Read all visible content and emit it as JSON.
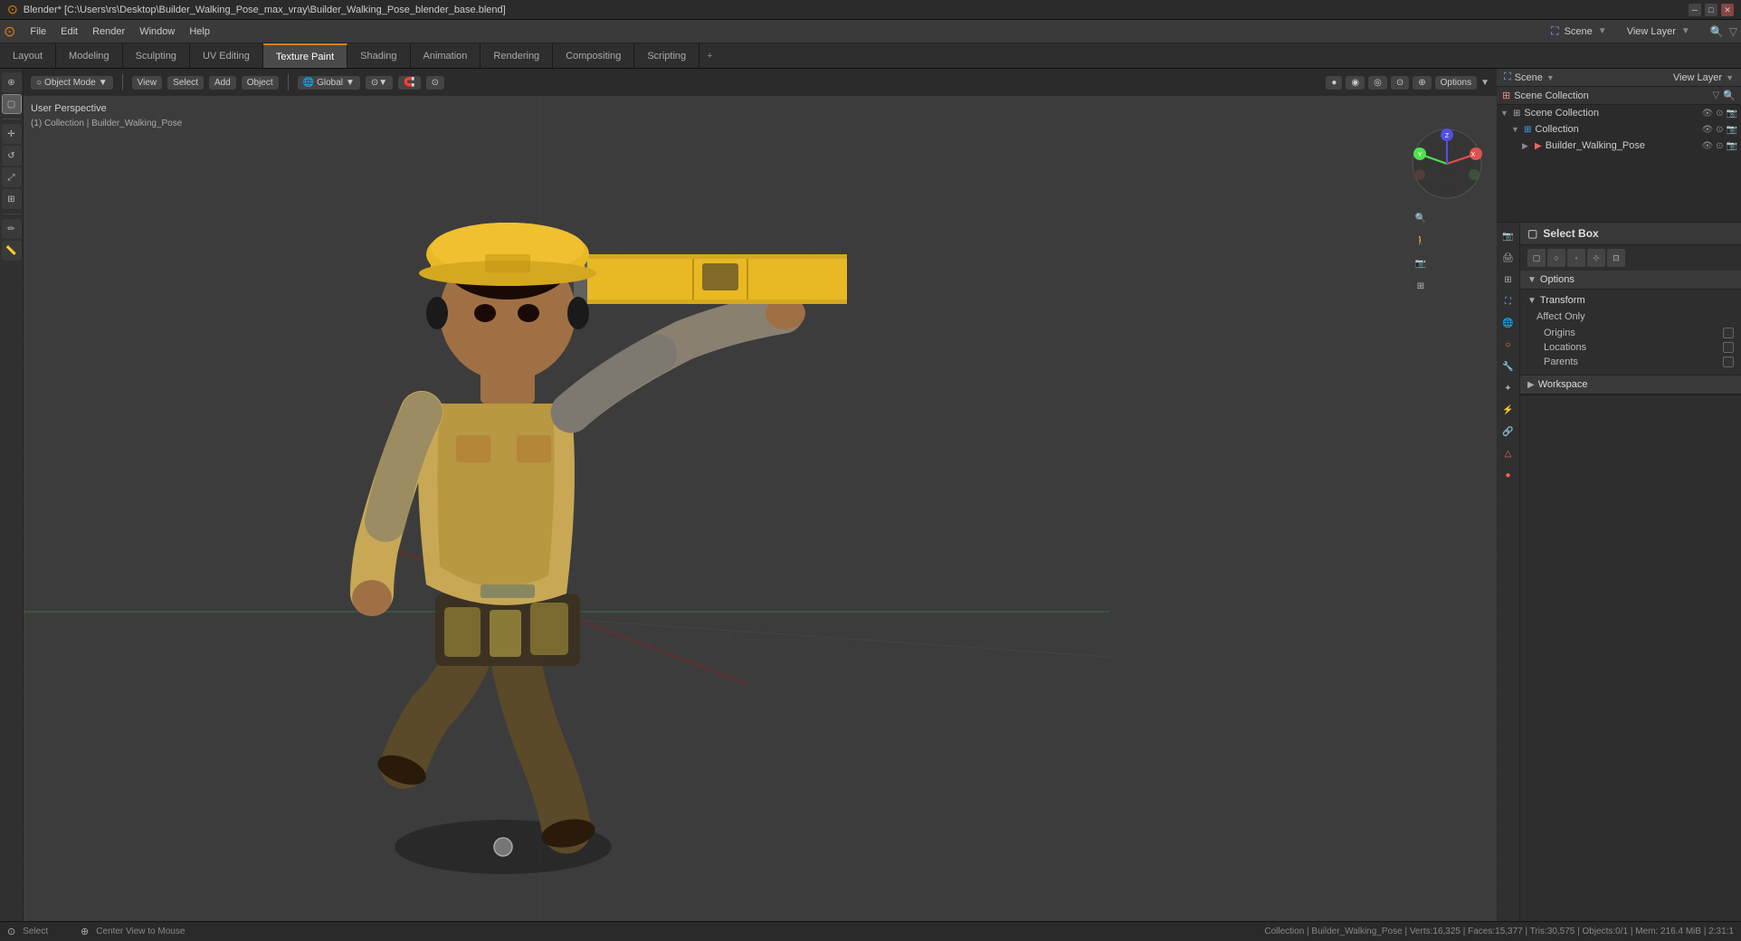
{
  "titlebar": {
    "title": "Blender* [C:\\Users\\rs\\Desktop\\Builder_Walking_Pose_max_vray\\Builder_Walking_Pose_blender_base.blend]"
  },
  "menubar": {
    "items": [
      "File",
      "Edit",
      "Render",
      "Window",
      "Help"
    ]
  },
  "workspacetabs": {
    "tabs": [
      "Layout",
      "Modeling",
      "Sculpting",
      "UV Editing",
      "Texture Paint",
      "Shading",
      "Animation",
      "Rendering",
      "Compositing",
      "Scripting"
    ],
    "active": "Texture Paint",
    "add_label": "+"
  },
  "viewport": {
    "mode_label": "Object Mode",
    "view_label": "View",
    "select_label": "Select",
    "add_label": "Add",
    "object_label": "Object",
    "perspective_label": "User Perspective",
    "collection_label": "(1) Collection | Builder_Walking_Pose",
    "transform_global": "Global",
    "options_label": "Options"
  },
  "outliner": {
    "header": "Scene Collection",
    "items": [
      {
        "indent": 0,
        "label": "Collection",
        "icon": "▶",
        "color": "#e8e8"
      },
      {
        "indent": 1,
        "label": "Builder_Walking_Pose",
        "icon": "▶",
        "color": "#e66"
      }
    ]
  },
  "properties": {
    "select_box_label": "Select Box",
    "tool_icons": [
      "□",
      "□",
      "□",
      "□",
      "□"
    ],
    "options_label": "Options",
    "transform_label": "Transform",
    "affect_only_label": "Affect Only",
    "origins_label": "Origins",
    "locations_label": "Locations",
    "parents_label": "Parents",
    "workspace_label": "Workspace"
  },
  "statusbar": {
    "left_label": "Select",
    "center_label": "Center View to Mouse",
    "stats": "Collection | Builder_Walking_Pose | Verts:16,325 | Faces:15,377 | Tris:30,575 | Objects:0/1 | Mem: 216.4 MiB | 2:31:1"
  },
  "colors": {
    "accent": "#e88000",
    "active_tab_bg": "#4a4a4a",
    "bg_dark": "#2e2e2e",
    "bg_mid": "#3a3a3a",
    "bg_light": "#444444"
  },
  "icons": {
    "cursor": "⊕",
    "select": "▢",
    "move": "✛",
    "rotate": "↺",
    "scale": "⤢",
    "transform": "⊞",
    "annotate": "✏",
    "measure": "📏",
    "camera": "📷",
    "gear": "⚙",
    "search": "🔍",
    "expand": "▶",
    "collapse": "▼",
    "eye": "👁",
    "lock": "🔒",
    "filter": "▽",
    "scene": "⛶",
    "world": "🌐",
    "object": "○",
    "modifier": "🔧",
    "particle": "✦",
    "physics": "⚡",
    "constraint": "🔗",
    "data": "△",
    "material": "●",
    "render": "📷"
  }
}
